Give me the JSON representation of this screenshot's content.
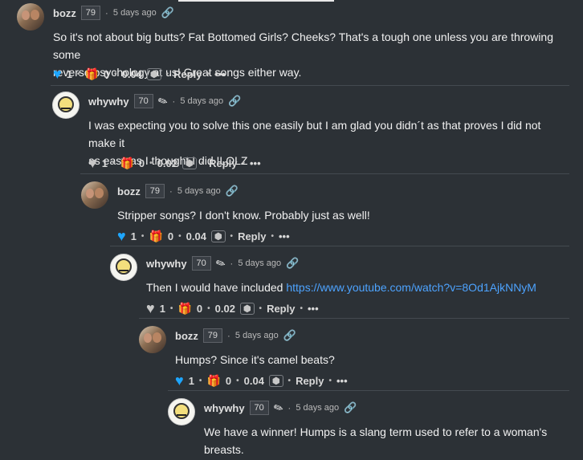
{
  "comments": [
    {
      "author": "bozz",
      "reputation": "79",
      "time": "5 days ago",
      "avatar_icon": "profile-photo",
      "body_lines": [
        "So it's not about big butts? Fat Bottomed Girls? Cheeks? That's a tough one unless you are throwing some",
        "reverse psychology at us! Great songs either way."
      ],
      "heart_color": "#1ea6ff",
      "votes": "1",
      "gifts": "0",
      "payout": "0.04",
      "reply_label": "Reply",
      "more_label": "•••"
    },
    {
      "author": "whywhy",
      "reputation": "70",
      "time": "5 days ago",
      "avatar_icon": "cartoon-face",
      "body_lines": [
        "I was expecting you to solve this one easily but I am glad you didn´t as that proves I did not make it",
        "as easy as I thought I did !LOLZ"
      ],
      "heart_color": "#c7c7c7",
      "votes": "1",
      "gifts": "0",
      "payout": "0.02",
      "reply_label": "Reply",
      "more_label": "•••"
    },
    {
      "author": "bozz",
      "reputation": "79",
      "time": "5 days ago",
      "avatar_icon": "profile-photo",
      "body_lines": [
        "Stripper songs? I don't know. Probably just as well!"
      ],
      "heart_color": "#1ea6ff",
      "votes": "1",
      "gifts": "0",
      "payout": "0.04",
      "reply_label": "Reply",
      "more_label": "•••"
    },
    {
      "author": "whywhy",
      "reputation": "70",
      "time": "5 days ago",
      "avatar_icon": "cartoon-face",
      "body_prefix": "Then I would have included ",
      "body_link": "https://www.youtube.com/watch?v=8Od1AjkNNyM",
      "heart_color": "#c7c7c7",
      "votes": "1",
      "gifts": "0",
      "payout": "0.02",
      "reply_label": "Reply",
      "more_label": "•••"
    },
    {
      "author": "bozz",
      "reputation": "79",
      "time": "5 days ago",
      "avatar_icon": "profile-photo",
      "body_lines": [
        "Humps? Since it's camel beats?"
      ],
      "heart_color": "#1ea6ff",
      "votes": "1",
      "gifts": "0",
      "payout": "0.04",
      "reply_label": "Reply",
      "more_label": "•••"
    },
    {
      "author": "whywhy",
      "reputation": "70",
      "time": "5 days ago",
      "avatar_icon": "cartoon-face",
      "body_lines": [
        "We have a winner! Humps is a slang term used to refer to a woman's",
        "breasts."
      ]
    }
  ]
}
